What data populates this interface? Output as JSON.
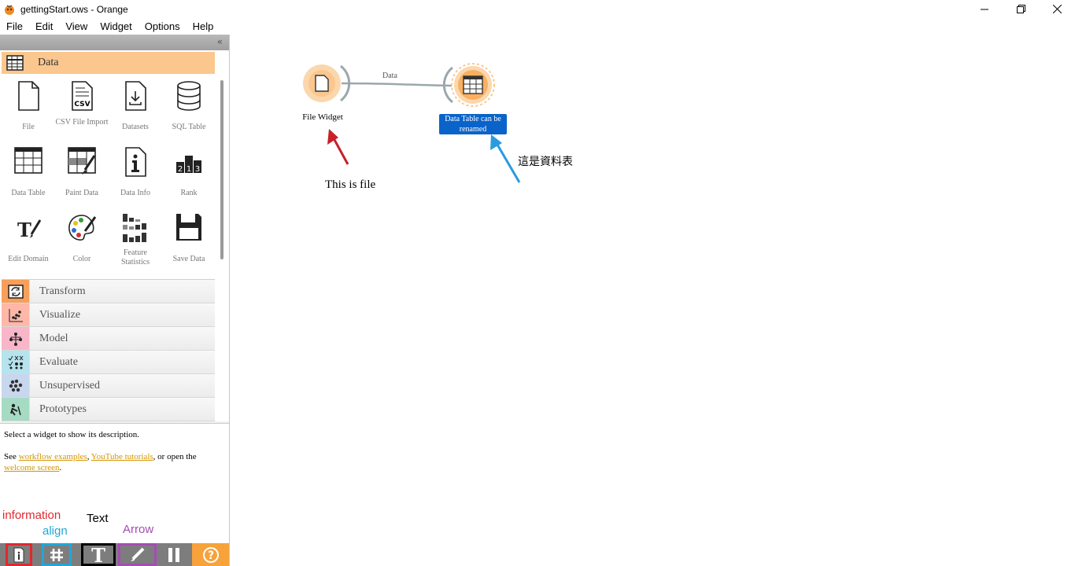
{
  "window": {
    "title": "gettingStart.ows - Orange"
  },
  "menu": [
    "File",
    "Edit",
    "View",
    "Widget",
    "Options",
    "Help"
  ],
  "toolbox": {
    "active_category": "Data",
    "widgets": [
      {
        "label": "File"
      },
      {
        "label": "CSV File Import"
      },
      {
        "label": "Datasets"
      },
      {
        "label": "SQL Table"
      },
      {
        "label": "Data Table"
      },
      {
        "label": "Paint Data"
      },
      {
        "label": "Data Info"
      },
      {
        "label": "Rank"
      },
      {
        "label": "Edit Domain"
      },
      {
        "label": "Color"
      },
      {
        "label": "Feature Statistics"
      },
      {
        "label": "Save Data"
      }
    ],
    "categories": [
      {
        "label": "Transform",
        "color": "#f99f59"
      },
      {
        "label": "Visualize",
        "color": "#ffb7a8"
      },
      {
        "label": "Model",
        "color": "#f8b6c8"
      },
      {
        "label": "Evaluate",
        "color": "#b5e3ee"
      },
      {
        "label": "Unsupervised",
        "color": "#c7d7ee"
      },
      {
        "label": "Prototypes",
        "color": "#a6dbc3"
      }
    ]
  },
  "description": {
    "line1": "Select a widget to show its description.",
    "see": "See ",
    "link1": "workflow examples",
    "sep": ", ",
    "link2": "YouTube tutorials",
    "or": ", or open the",
    "link3": "welcome screen",
    "end": "."
  },
  "toolbar_labels": {
    "information": "information",
    "align": "align",
    "text": "Text",
    "arrow": "Arrow"
  },
  "canvas": {
    "link_label": "Data",
    "node1": "File Widget",
    "node2": "Data Table can be renamed",
    "annotation1": "This is file",
    "annotation2": "這是資料表"
  },
  "colors": {
    "data_category": "#fbc78e",
    "info_box": "#e0282e",
    "align_box": "#22a6d8",
    "text_box": "#000000",
    "arrow_box": "#a64cb5",
    "help_button": "#f7a23b",
    "red_arrow": "#c8202a",
    "blue_arrow": "#2b9be0",
    "selection": "#0a63c9"
  }
}
